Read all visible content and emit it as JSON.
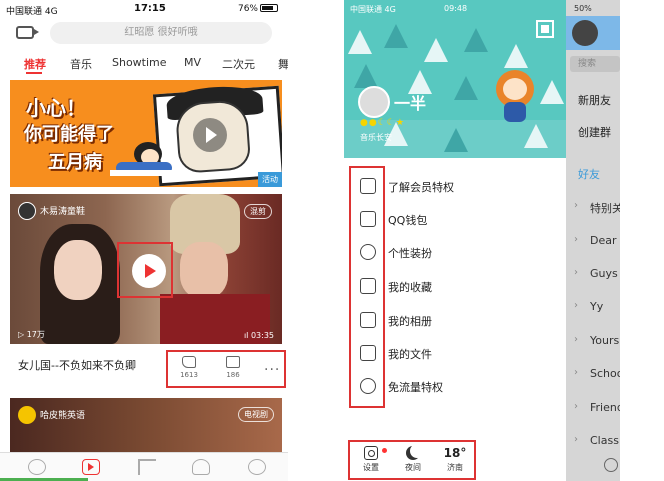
{
  "left_phone": {
    "status": {
      "carrier": "中国联通 4G",
      "time": "17:15",
      "battery": "76%"
    },
    "search": {
      "placeholder": "红昭愿 很好听哦"
    },
    "tabs": [
      "推荐",
      "音乐",
      "Showtime",
      "MV",
      "二次元",
      "舞"
    ],
    "active_tab": 0,
    "banner": {
      "line1": "小心！",
      "line2": "你可能得了",
      "line3": "五月病",
      "badge": "活动"
    },
    "video": {
      "author": "木易涛童鞋",
      "tag": "混剪",
      "views": "17万",
      "duration": "03:35",
      "title": "女儿国--不负如来不负卿",
      "likes": "1613",
      "comments": "186",
      "more": "···"
    },
    "video2": {
      "author": "哈皮熊英语",
      "tag": "电视剧"
    },
    "bottom_nav": [
      "disc-icon",
      "video-play-icon",
      "music-note-icon",
      "people-icon",
      "profile-icon"
    ],
    "accent": "#e33333"
  },
  "right_phone": {
    "status": {
      "carrier": "中国联通 4G",
      "time": "09:48",
      "side_battery": "50%"
    },
    "profile": {
      "nickname": "一半",
      "signature": "音乐长安"
    },
    "menu": [
      {
        "icon": "vip-crown-icon",
        "label": "了解会员特权"
      },
      {
        "icon": "wallet-icon",
        "label": "QQ钱包"
      },
      {
        "icon": "palette-icon",
        "label": "个性装扮"
      },
      {
        "icon": "bookmark-star-icon",
        "label": "我的收藏"
      },
      {
        "icon": "photo-album-icon",
        "label": "我的相册"
      },
      {
        "icon": "folder-icon",
        "label": "我的文件"
      },
      {
        "icon": "signal-tower-icon",
        "label": "免流量特权"
      }
    ],
    "bottom": {
      "settings": "设置",
      "night": "夜间",
      "temperature": "18°",
      "city": "济南"
    },
    "side": {
      "search": "搜索",
      "items": [
        "新朋友",
        "创建群"
      ],
      "friends_tab": "好友",
      "groups": [
        "特别关心",
        "Dear",
        "Guys",
        "Yy",
        "Yours",
        "School",
        "Friends",
        "Class"
      ]
    },
    "header_color": "#58c8c0"
  }
}
